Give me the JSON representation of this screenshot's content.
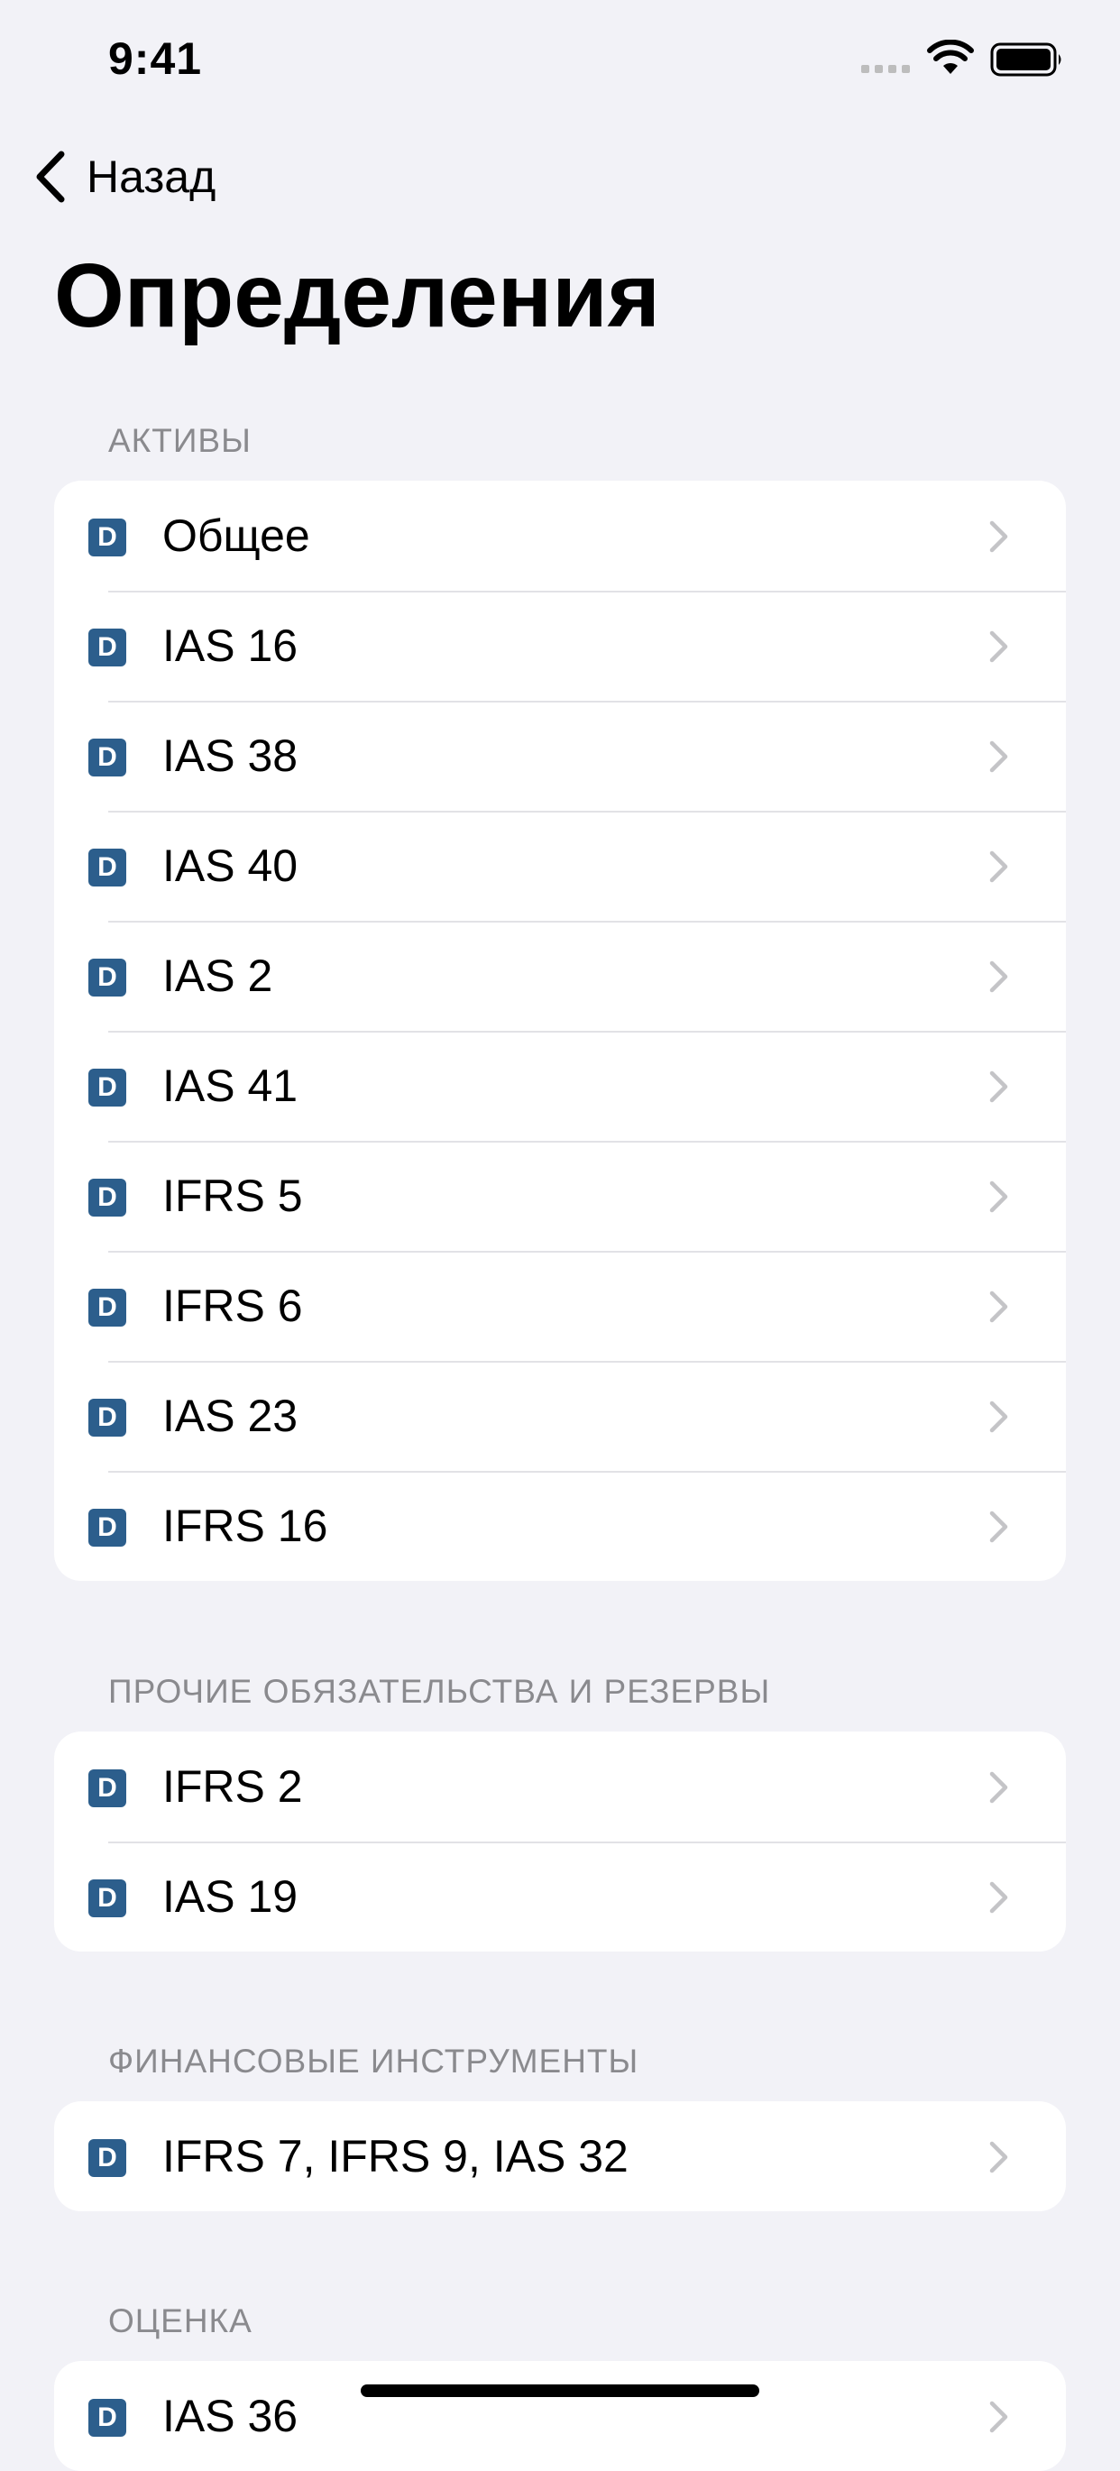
{
  "status_bar": {
    "time": "9:41"
  },
  "nav": {
    "back_label": "Назад"
  },
  "page": {
    "title": "Определения"
  },
  "sections": [
    {
      "header": "АКТИВЫ",
      "items": [
        "Общее",
        "IAS 16",
        "IAS 38",
        "IAS 40",
        "IAS 2",
        "IAS 41",
        "IFRS 5",
        "IFRS 6",
        "IAS 23",
        "IFRS 16"
      ]
    },
    {
      "header": "ПРОЧИЕ ОБЯЗАТЕЛЬСТВА И РЕЗЕРВЫ",
      "items": [
        "IFRS 2",
        "IAS 19"
      ]
    },
    {
      "header": "ФИНАНСОВЫЕ ИНСТРУМЕНТЫ",
      "items": [
        "IFRS 7, IFRS 9, IAS 32"
      ]
    },
    {
      "header": "ОЦЕНКА",
      "items": [
        "IAS 36"
      ]
    }
  ],
  "item_icon": {
    "letter": "D",
    "color": "#2C5E8C",
    "name": "definition-icon"
  },
  "colors": {
    "background": "#F2F2F7",
    "card": "#FFFFFF",
    "section_header": "#8A8A8E",
    "chevron": "#C4C4C7"
  }
}
